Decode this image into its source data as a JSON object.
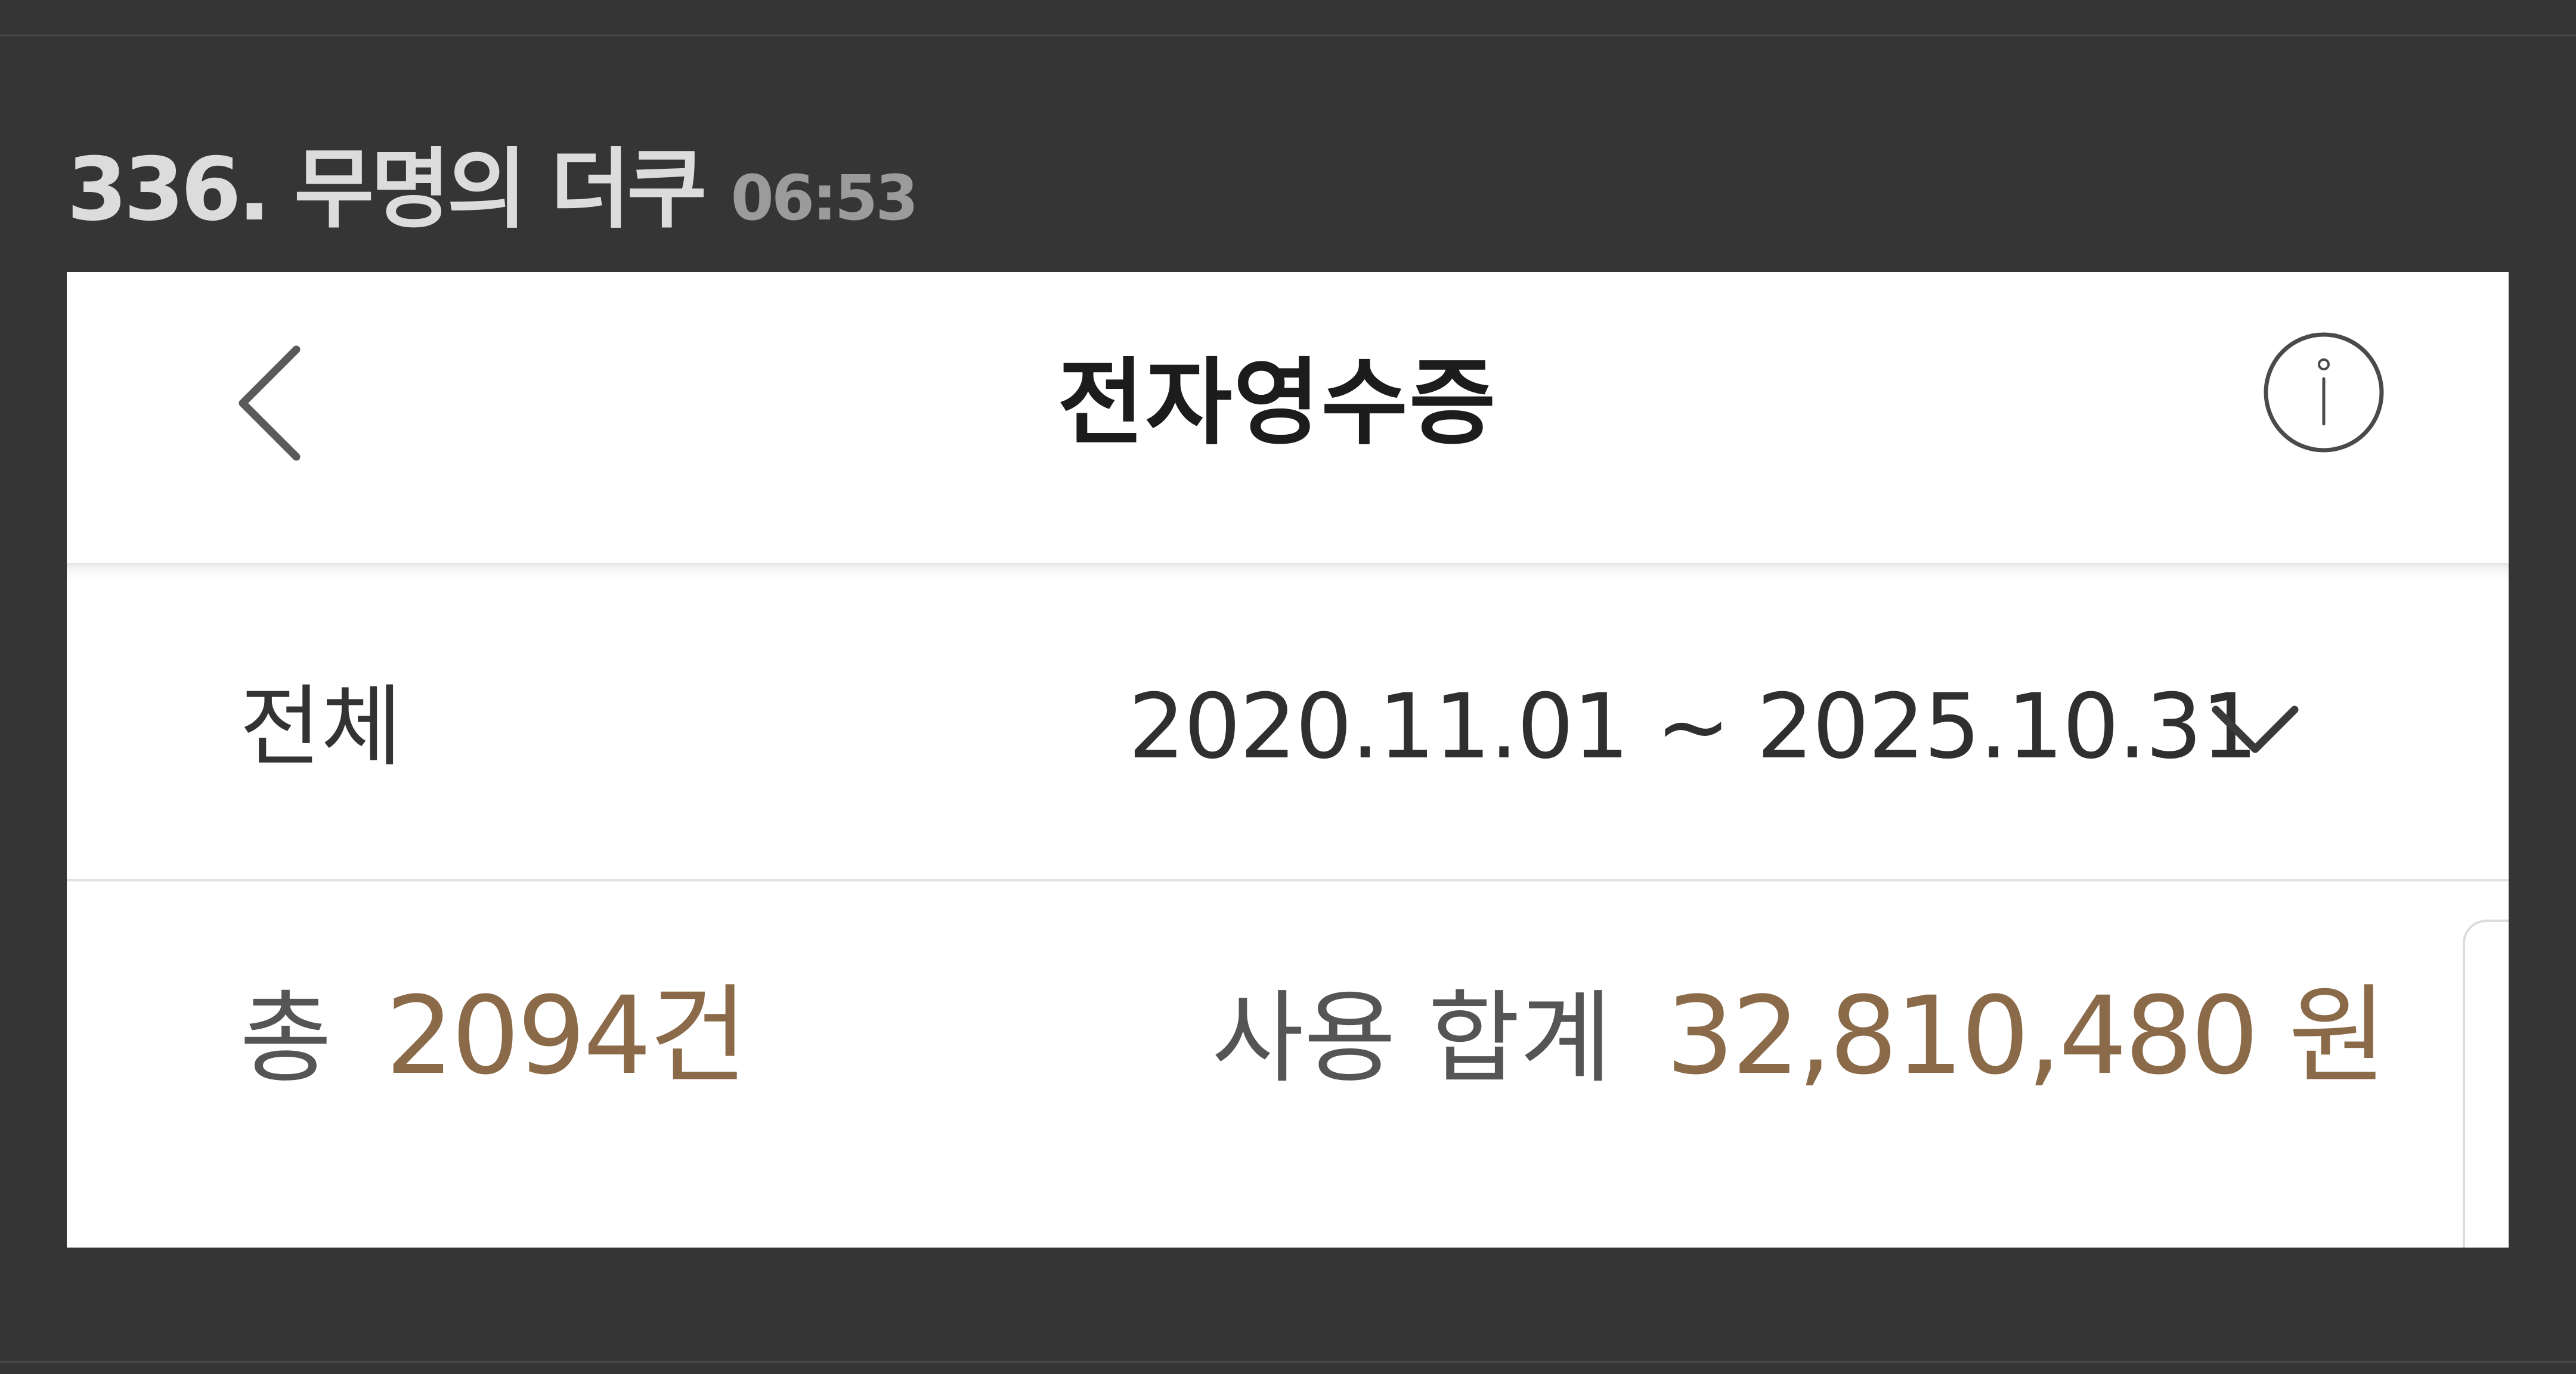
{
  "post": {
    "title": "336. 무명의 더쿠",
    "time": "06:53"
  },
  "app_screen": {
    "title": "전자영수증",
    "back_icon": "chevron-left-icon",
    "info_icon": "info-circle-icon",
    "filter": {
      "label": "전체",
      "date_range": "2020.11.01 ~ 2025.10.31",
      "dropdown_icon": "chevron-down-icon"
    },
    "summary": {
      "count_prefix": "총",
      "count_value": "2094건",
      "total_label": "사용 합계",
      "total_value": "32,810,480 원"
    }
  },
  "colors": {
    "background": "#353535",
    "card": "#ffffff",
    "accent_brown": "#8a6a48",
    "header_text": "#dcdcdc",
    "time_text": "#9b9b9b"
  }
}
